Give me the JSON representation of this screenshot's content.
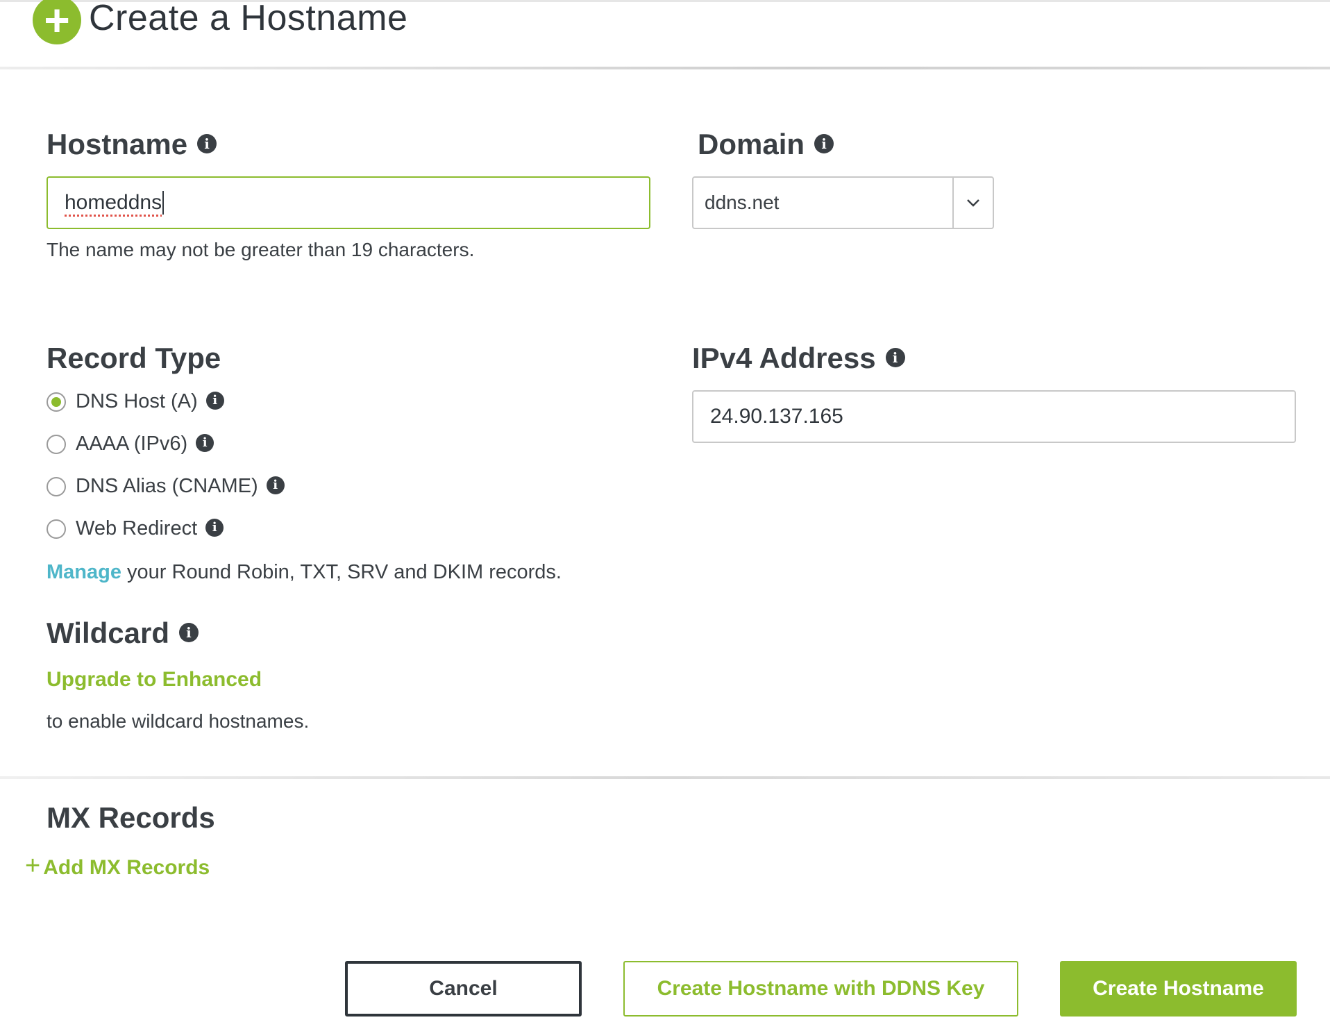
{
  "header": {
    "title": "Create a Hostname",
    "plus_icon": "+"
  },
  "hostname": {
    "label": "Hostname",
    "value": "homeddns",
    "hint": "The name may not be greater than 19 characters."
  },
  "domain": {
    "label": "Domain",
    "selected": "ddns.net"
  },
  "record_type": {
    "label": "Record Type",
    "options": [
      {
        "label": "DNS Host (A)",
        "checked": true
      },
      {
        "label": "AAAA (IPv6)",
        "checked": false
      },
      {
        "label": "DNS Alias (CNAME)",
        "checked": false
      },
      {
        "label": "Web Redirect",
        "checked": false
      }
    ],
    "manage_link": "Manage",
    "manage_text": "your Round Robin, TXT, SRV and DKIM records."
  },
  "ipv4": {
    "label": "IPv4 Address",
    "value": "24.90.137.165"
  },
  "wildcard": {
    "label": "Wildcard",
    "upgrade_link": "Upgrade to Enhanced",
    "text": "to enable wildcard hostnames."
  },
  "mx": {
    "label": "MX Records",
    "add_icon": "+",
    "add_label": "Add MX Records"
  },
  "buttons": {
    "cancel": "Cancel",
    "create_with_key": "Create Hostname with DDNS Key",
    "create": "Create Hostname"
  },
  "info_glyph": "i",
  "colors": {
    "accent_green": "#8cbc2e",
    "link_teal": "#4eb6c9",
    "text_dark": "#3a3f44"
  }
}
